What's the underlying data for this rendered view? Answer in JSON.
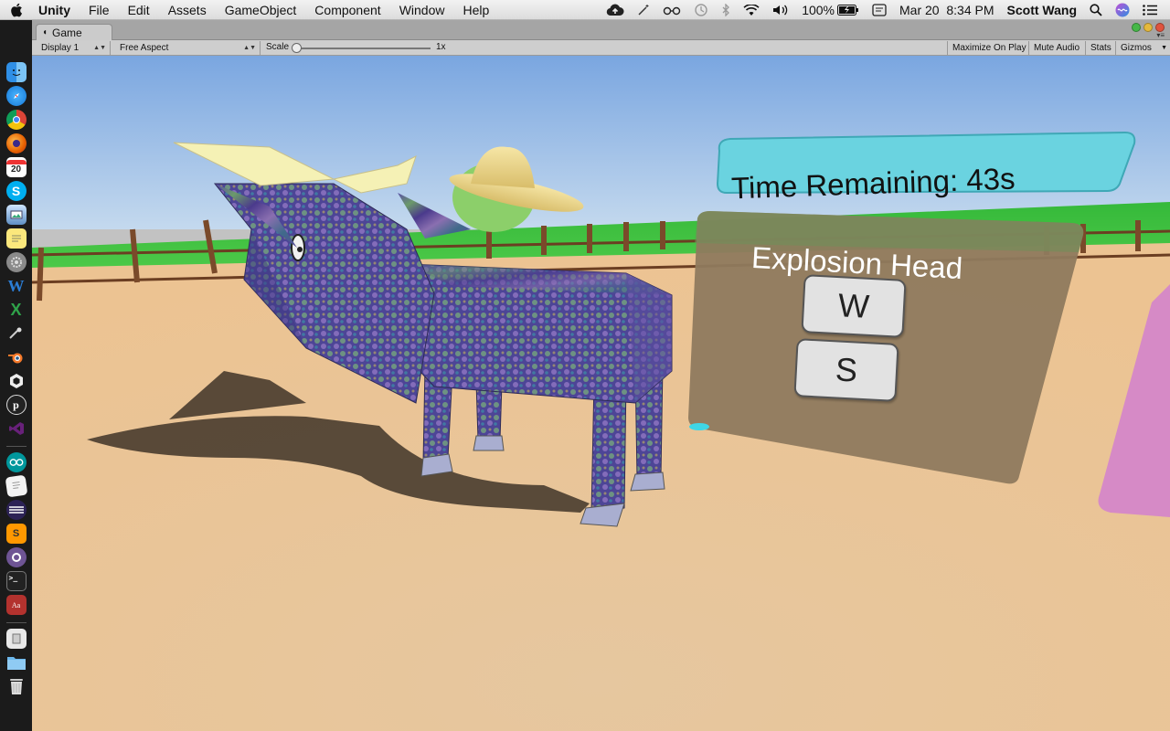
{
  "menubar": {
    "app_name": "Unity",
    "menus": [
      "File",
      "Edit",
      "Assets",
      "GameObject",
      "Component",
      "Window",
      "Help"
    ],
    "battery": "100%",
    "date": "Mar 20",
    "time": "8:34 PM",
    "user": "Scott Wang"
  },
  "tab": {
    "label": "Game"
  },
  "toolbar": {
    "display": "Display 1",
    "aspect": "Free Aspect",
    "scale_label": "Scale",
    "scale_value": "1x",
    "scale_fraction": 0,
    "maximize": "Maximize On Play",
    "mute": "Mute Audio",
    "stats": "Stats",
    "gizmos": "Gizmos"
  },
  "game": {
    "timer": "Time Remaining: 43s",
    "quiz_title": "Explosion Head",
    "keys": [
      "W",
      "S"
    ]
  },
  "dock": {
    "calendar_day": "20",
    "icons": [
      "finder-icon",
      "safari-icon",
      "chrome-icon",
      "firefox-icon",
      "calendar-icon",
      "skype-icon",
      "preview-icon",
      "notes-icon",
      "system-preferences-icon",
      "word-icon",
      "excel-icon",
      "script-editor-icon",
      "blender-icon",
      "unity-icon",
      "p5-icon",
      "visual-studio-icon",
      "arduino-icon",
      "textedit-icon",
      "eclipse-icon",
      "sublime-icon",
      "github-icon",
      "terminal-icon",
      "dictionary-icon",
      "automator-icon",
      "folder-icon",
      "trash-icon"
    ]
  },
  "colors": {
    "timer_bar": "#6ad3e0",
    "quiz_panel": "#8f7a5e",
    "ground": "#e8c79b",
    "grass": "#3fbf3f",
    "sky": "#8fb8e6"
  }
}
